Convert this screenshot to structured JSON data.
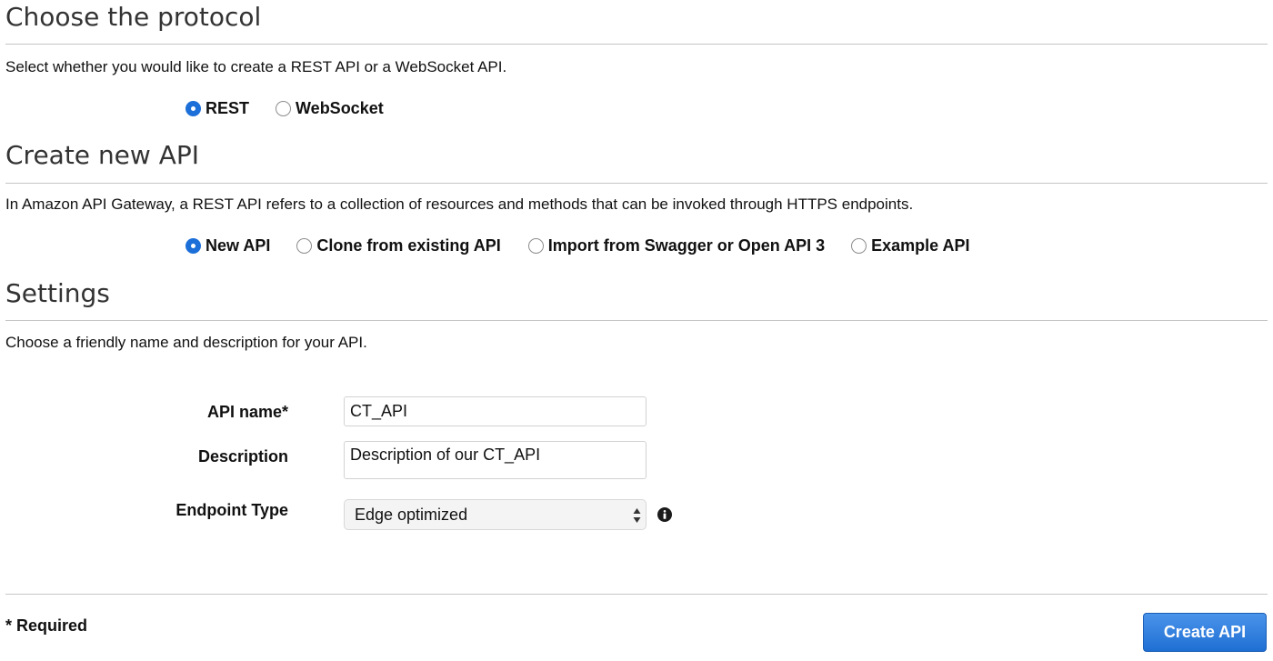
{
  "protocol": {
    "title": "Choose the protocol",
    "description": "Select whether you would like to create a REST API or a WebSocket API.",
    "options": [
      {
        "label": "REST",
        "selected": true
      },
      {
        "label": "WebSocket",
        "selected": false
      }
    ]
  },
  "create_new_api": {
    "title": "Create new API",
    "description": "In Amazon API Gateway, a REST API refers to a collection of resources and methods that can be invoked through HTTPS endpoints.",
    "options": [
      {
        "label": "New API",
        "selected": true
      },
      {
        "label": "Clone from existing API",
        "selected": false
      },
      {
        "label": "Import from Swagger or Open API 3",
        "selected": false
      },
      {
        "label": "Example API",
        "selected": false
      }
    ]
  },
  "settings": {
    "title": "Settings",
    "description": "Choose a friendly name and description for your API.",
    "api_name": {
      "label": "API name*",
      "value": "CT_API"
    },
    "api_description": {
      "label": "Description",
      "value": "Description of our CT_API"
    },
    "endpoint_type": {
      "label": "Endpoint Type",
      "value": "Edge optimized",
      "info_icon": "info-circle-icon"
    }
  },
  "footer": {
    "required_note": "* Required",
    "create_button": "Create API"
  },
  "colors": {
    "accent": "#1c6fd8",
    "button_top": "#4a93ea",
    "button_bottom": "#1f6fd3",
    "divider": "#c6c6c6",
    "heading": "#333333"
  }
}
